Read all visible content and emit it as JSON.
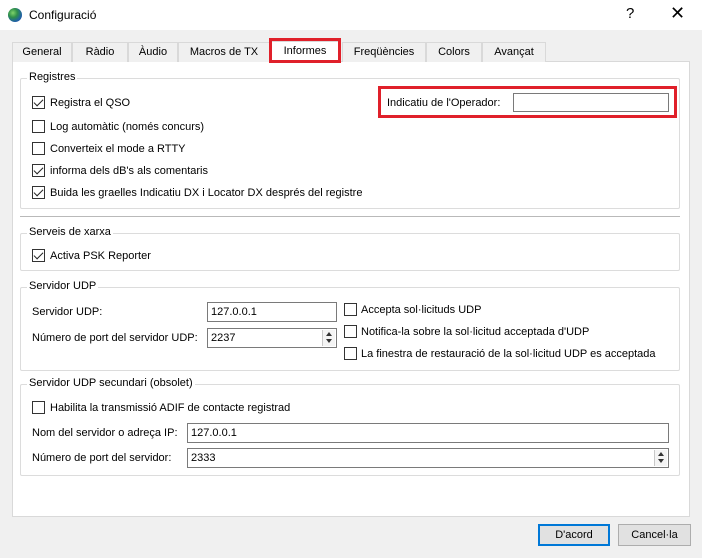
{
  "window": {
    "title": "Configuració",
    "help_symbol": "?",
    "close_symbol": "✕",
    "icon": "app-globe-icon"
  },
  "tabs": [
    {
      "label": "General"
    },
    {
      "label": "Ràdio"
    },
    {
      "label": "Àudio"
    },
    {
      "label": "Macros de TX"
    },
    {
      "label": "Informes",
      "active": true
    },
    {
      "label": "Freqüències"
    },
    {
      "label": "Colors"
    },
    {
      "label": "Avançat"
    }
  ],
  "registres": {
    "title": "Registres",
    "log_qso": {
      "label": "Registra el QSO",
      "checked": true
    },
    "auto_log": {
      "label": "Log automàtic (només concurs)",
      "checked": false
    },
    "convert_rtty": {
      "label": "Converteix el mode a RTTY",
      "checked": false
    },
    "db_comments": {
      "label": "informa dels dB's als comentaris",
      "checked": true
    },
    "clear_grids": {
      "label": "Buida les graelles Indicatiu DX i Locator DX després del registre",
      "checked": true
    },
    "operator_label": "Indicatiu de l'Operador:",
    "operator_value": ""
  },
  "serveis": {
    "title": "Serveis de xarxa",
    "psk": {
      "label": "Activa PSK Reporter",
      "checked": true
    }
  },
  "udp": {
    "title": "Servidor UDP",
    "server_label": "Servidor UDP:",
    "server_value": "127.0.0.1",
    "port_label": "Número de port del servidor UDP:",
    "port_value": "2237",
    "accept": {
      "label": "Accepta sol·licituds UDP",
      "checked": false
    },
    "notify": {
      "label": "Notifica-la sobre la sol·licitud acceptada d'UDP",
      "checked": false
    },
    "restore": {
      "label": "La finestra de restauració de la sol·licitud UDP es acceptada",
      "checked": false
    }
  },
  "udp2": {
    "title": "Servidor UDP secundari (obsolet)",
    "adif": {
      "label": "Habilita la transmissió ADIF de contacte registrad",
      "checked": false
    },
    "name_label": "Nom del servidor o adreça IP:",
    "name_value": "127.0.0.1",
    "port_label": "Número de port del servidor:",
    "port_value": "2333"
  },
  "buttons": {
    "ok": "D'acord",
    "cancel": "Cancel·la"
  },
  "colors": {
    "highlight": "#e0202a",
    "default_button": "#0078d7"
  }
}
